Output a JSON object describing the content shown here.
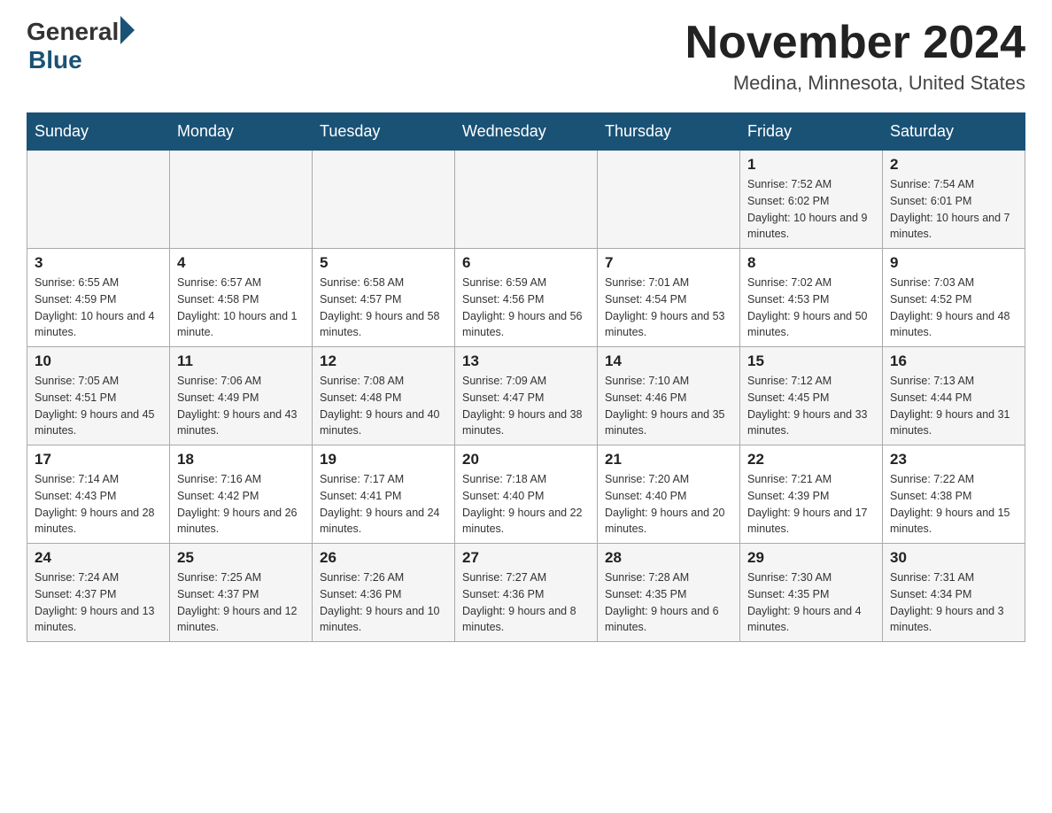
{
  "header": {
    "logo_general": "General",
    "logo_blue": "Blue",
    "month_title": "November 2024",
    "location": "Medina, Minnesota, United States"
  },
  "days_of_week": [
    "Sunday",
    "Monday",
    "Tuesday",
    "Wednesday",
    "Thursday",
    "Friday",
    "Saturday"
  ],
  "weeks": [
    {
      "row_class": "row-odd",
      "days": [
        {
          "number": "",
          "info": ""
        },
        {
          "number": "",
          "info": ""
        },
        {
          "number": "",
          "info": ""
        },
        {
          "number": "",
          "info": ""
        },
        {
          "number": "",
          "info": ""
        },
        {
          "number": "1",
          "info": "Sunrise: 7:52 AM\nSunset: 6:02 PM\nDaylight: 10 hours and 9 minutes."
        },
        {
          "number": "2",
          "info": "Sunrise: 7:54 AM\nSunset: 6:01 PM\nDaylight: 10 hours and 7 minutes."
        }
      ]
    },
    {
      "row_class": "row-even",
      "days": [
        {
          "number": "3",
          "info": "Sunrise: 6:55 AM\nSunset: 4:59 PM\nDaylight: 10 hours and 4 minutes."
        },
        {
          "number": "4",
          "info": "Sunrise: 6:57 AM\nSunset: 4:58 PM\nDaylight: 10 hours and 1 minute."
        },
        {
          "number": "5",
          "info": "Sunrise: 6:58 AM\nSunset: 4:57 PM\nDaylight: 9 hours and 58 minutes."
        },
        {
          "number": "6",
          "info": "Sunrise: 6:59 AM\nSunset: 4:56 PM\nDaylight: 9 hours and 56 minutes."
        },
        {
          "number": "7",
          "info": "Sunrise: 7:01 AM\nSunset: 4:54 PM\nDaylight: 9 hours and 53 minutes."
        },
        {
          "number": "8",
          "info": "Sunrise: 7:02 AM\nSunset: 4:53 PM\nDaylight: 9 hours and 50 minutes."
        },
        {
          "number": "9",
          "info": "Sunrise: 7:03 AM\nSunset: 4:52 PM\nDaylight: 9 hours and 48 minutes."
        }
      ]
    },
    {
      "row_class": "row-odd",
      "days": [
        {
          "number": "10",
          "info": "Sunrise: 7:05 AM\nSunset: 4:51 PM\nDaylight: 9 hours and 45 minutes."
        },
        {
          "number": "11",
          "info": "Sunrise: 7:06 AM\nSunset: 4:49 PM\nDaylight: 9 hours and 43 minutes."
        },
        {
          "number": "12",
          "info": "Sunrise: 7:08 AM\nSunset: 4:48 PM\nDaylight: 9 hours and 40 minutes."
        },
        {
          "number": "13",
          "info": "Sunrise: 7:09 AM\nSunset: 4:47 PM\nDaylight: 9 hours and 38 minutes."
        },
        {
          "number": "14",
          "info": "Sunrise: 7:10 AM\nSunset: 4:46 PM\nDaylight: 9 hours and 35 minutes."
        },
        {
          "number": "15",
          "info": "Sunrise: 7:12 AM\nSunset: 4:45 PM\nDaylight: 9 hours and 33 minutes."
        },
        {
          "number": "16",
          "info": "Sunrise: 7:13 AM\nSunset: 4:44 PM\nDaylight: 9 hours and 31 minutes."
        }
      ]
    },
    {
      "row_class": "row-even",
      "days": [
        {
          "number": "17",
          "info": "Sunrise: 7:14 AM\nSunset: 4:43 PM\nDaylight: 9 hours and 28 minutes."
        },
        {
          "number": "18",
          "info": "Sunrise: 7:16 AM\nSunset: 4:42 PM\nDaylight: 9 hours and 26 minutes."
        },
        {
          "number": "19",
          "info": "Sunrise: 7:17 AM\nSunset: 4:41 PM\nDaylight: 9 hours and 24 minutes."
        },
        {
          "number": "20",
          "info": "Sunrise: 7:18 AM\nSunset: 4:40 PM\nDaylight: 9 hours and 22 minutes."
        },
        {
          "number": "21",
          "info": "Sunrise: 7:20 AM\nSunset: 4:40 PM\nDaylight: 9 hours and 20 minutes."
        },
        {
          "number": "22",
          "info": "Sunrise: 7:21 AM\nSunset: 4:39 PM\nDaylight: 9 hours and 17 minutes."
        },
        {
          "number": "23",
          "info": "Sunrise: 7:22 AM\nSunset: 4:38 PM\nDaylight: 9 hours and 15 minutes."
        }
      ]
    },
    {
      "row_class": "row-odd",
      "days": [
        {
          "number": "24",
          "info": "Sunrise: 7:24 AM\nSunset: 4:37 PM\nDaylight: 9 hours and 13 minutes."
        },
        {
          "number": "25",
          "info": "Sunrise: 7:25 AM\nSunset: 4:37 PM\nDaylight: 9 hours and 12 minutes."
        },
        {
          "number": "26",
          "info": "Sunrise: 7:26 AM\nSunset: 4:36 PM\nDaylight: 9 hours and 10 minutes."
        },
        {
          "number": "27",
          "info": "Sunrise: 7:27 AM\nSunset: 4:36 PM\nDaylight: 9 hours and 8 minutes."
        },
        {
          "number": "28",
          "info": "Sunrise: 7:28 AM\nSunset: 4:35 PM\nDaylight: 9 hours and 6 minutes."
        },
        {
          "number": "29",
          "info": "Sunrise: 7:30 AM\nSunset: 4:35 PM\nDaylight: 9 hours and 4 minutes."
        },
        {
          "number": "30",
          "info": "Sunrise: 7:31 AM\nSunset: 4:34 PM\nDaylight: 9 hours and 3 minutes."
        }
      ]
    }
  ]
}
